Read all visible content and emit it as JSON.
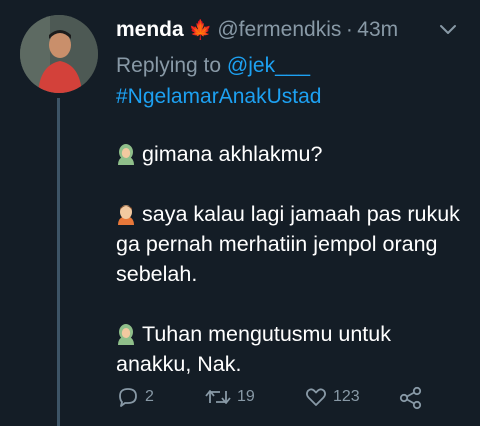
{
  "tweet": {
    "display_name": "menda",
    "badge_icon": "maple-leaf-icon",
    "handle": "@fermendkis",
    "separator": "·",
    "time": "43m",
    "replying_prefix": "Replying to ",
    "replying_to": "@jek___",
    "hashtag": "#NgelamarAnakUstad",
    "paragraphs": [
      {
        "icon": "person-with-headscarf-emoji",
        "text": "gimana akhlakmu?"
      },
      {
        "icon": "man-emoji",
        "text": "saya kalau lagi jamaah pas rukuk ga pernah merhatiin jempol orang sebelah."
      },
      {
        "icon": "person-with-headscarf-emoji",
        "text": "Tuhan mengutusmu untuk anakku, Nak."
      }
    ],
    "actions": {
      "reply_count": "2",
      "retweet_count": "19",
      "like_count": "123"
    }
  },
  "colors": {
    "background": "#141d26",
    "secondary_text": "#8899a6",
    "link": "#1da1f2",
    "thread_line": "#3d5466"
  }
}
